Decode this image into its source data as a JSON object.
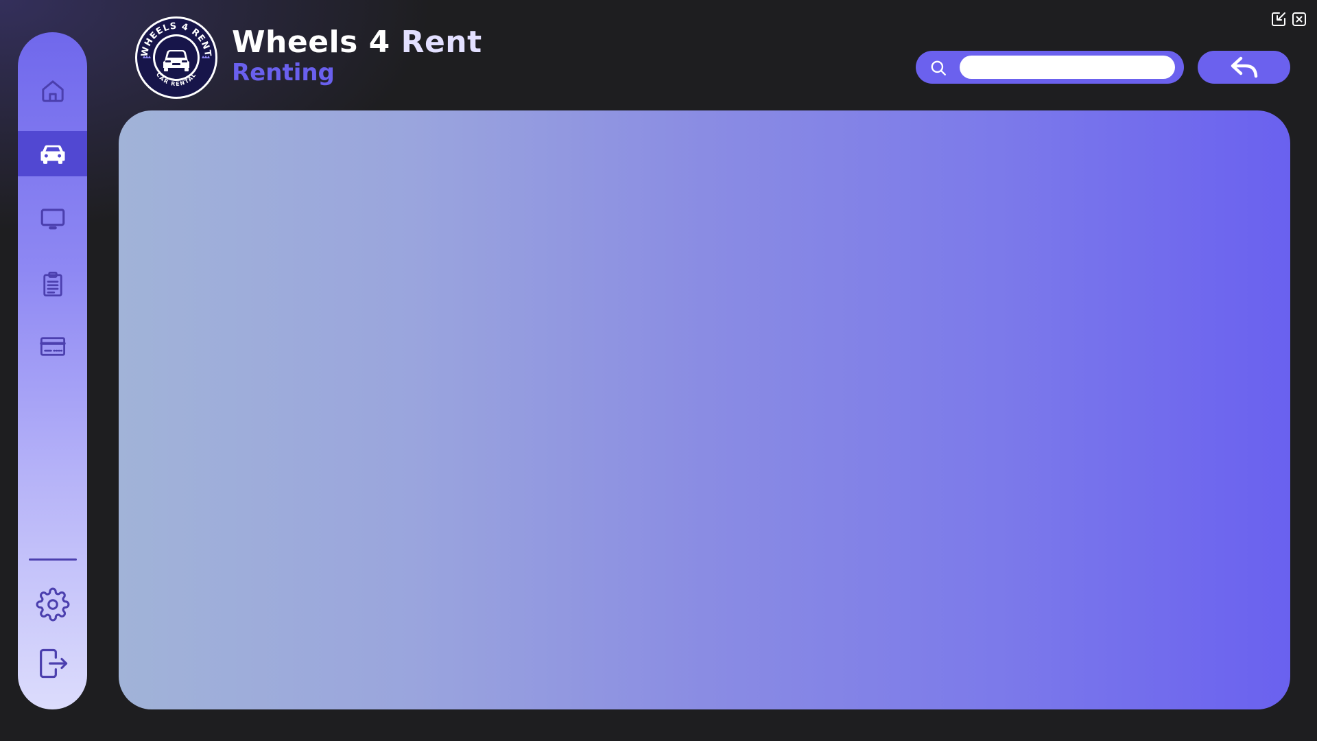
{
  "app": {
    "title_main": "Wheels 4",
    "title_accent": "Rent",
    "subtitle": "Renting"
  },
  "logo": {
    "top_text": "WHEELS 4 RENT",
    "bottom_text": "CAR RENTAL"
  },
  "sidebar": {
    "items": [
      {
        "name": "home",
        "icon": "home-icon",
        "active": false
      },
      {
        "name": "renting",
        "icon": "car-icon",
        "active": true
      },
      {
        "name": "monitor",
        "icon": "monitor-icon",
        "active": false
      },
      {
        "name": "reports",
        "icon": "clipboard-icon",
        "active": false
      },
      {
        "name": "payments",
        "icon": "credit-card-icon",
        "active": false
      }
    ],
    "bottom_items": [
      {
        "name": "settings",
        "icon": "gear-icon"
      },
      {
        "name": "logout",
        "icon": "logout-icon"
      }
    ]
  },
  "search": {
    "value": "",
    "placeholder": ""
  },
  "colors": {
    "accent": "#6b61ee",
    "active_nav": "#5148d2",
    "icon": "#4b3fae",
    "background": "#1e1e20"
  },
  "window_controls": [
    "minimize-icon",
    "close-icon"
  ]
}
